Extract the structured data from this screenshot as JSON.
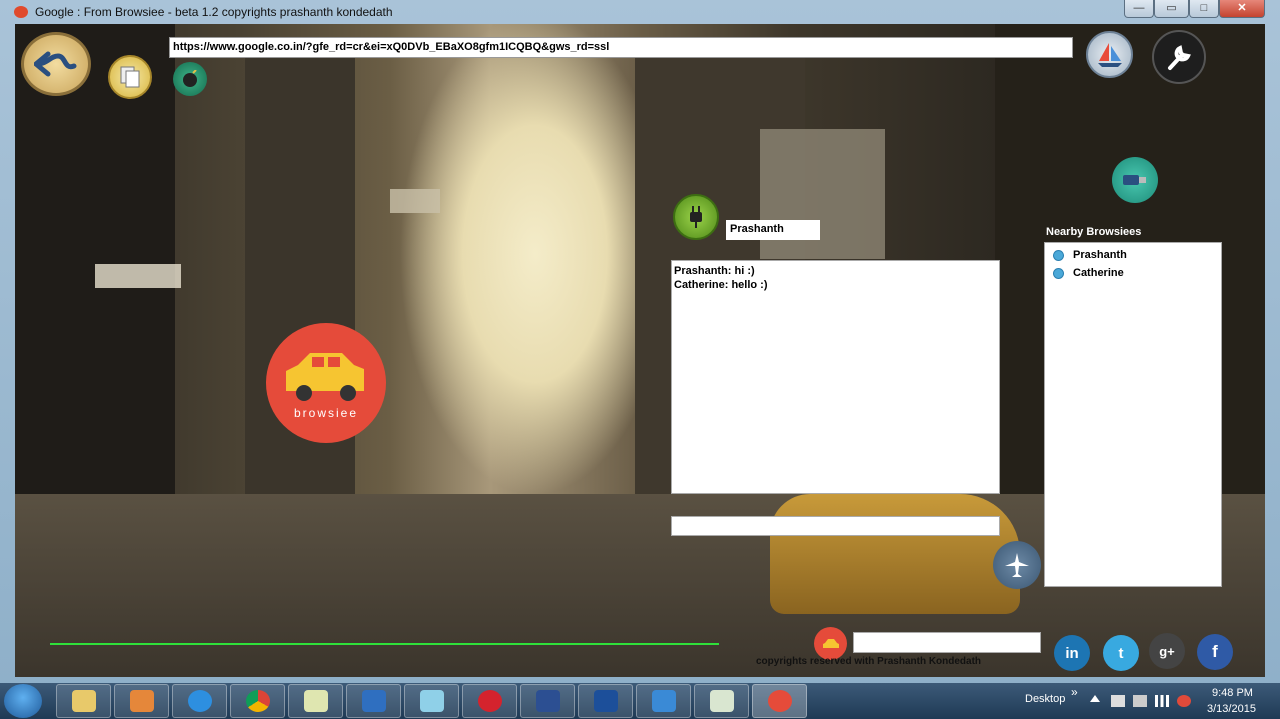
{
  "window": {
    "title": "Google : From Browsiee - beta 1.2 copyrights prashanth kondedath",
    "controls": {
      "minimize": "—",
      "extra": "▭",
      "maximize": "□",
      "close": "✕"
    }
  },
  "toolbar": {
    "url": "https://www.google.co.in/?gfe_rd=cr&ei=xQ0DVb_EBaXO8gfm1ICQBQ&gws_rd=ssl",
    "icons": [
      "back-icon",
      "documents-icon",
      "bomb-icon",
      "sailboat-icon",
      "wrench-icon",
      "usb-icon",
      "plug-icon",
      "airplane-icon"
    ]
  },
  "chat": {
    "name_value": "Prashanth",
    "messages": [
      "Prashanth: hi :)",
      "Catherine: hello :)"
    ],
    "input_value": ""
  },
  "nearby": {
    "title": "Nearby Browsiees",
    "users": [
      "Prashanth",
      "Catherine"
    ]
  },
  "logo": {
    "text": "browsiee",
    "color": "#e54b3a"
  },
  "footer": {
    "copyright": "copyrights reserved with Prashanth Kondedath",
    "input_value": "",
    "progress_percent": 100
  },
  "social": [
    "linkedin-icon",
    "twitter-icon",
    "google-plus-icon",
    "facebook-icon"
  ],
  "social_glyphs": {
    "linkedin": "in",
    "twitter": "t",
    "google_plus": "g+",
    "facebook": "f"
  },
  "colors": {
    "accent_green": "#2fe03a",
    "logo_red": "#e54b3a"
  },
  "taskbar": {
    "apps": [
      "file-explorer",
      "media-player",
      "internet-explorer",
      "chrome",
      "folder",
      "lync",
      "notepad",
      "creative-cloud",
      "visual-basic",
      "tm-app",
      "sharpdevelop",
      "presentation",
      "browsiee"
    ],
    "desktop_label": "Desktop",
    "chevron": "»",
    "time": "9:48 PM",
    "date": "3/13/2015"
  }
}
